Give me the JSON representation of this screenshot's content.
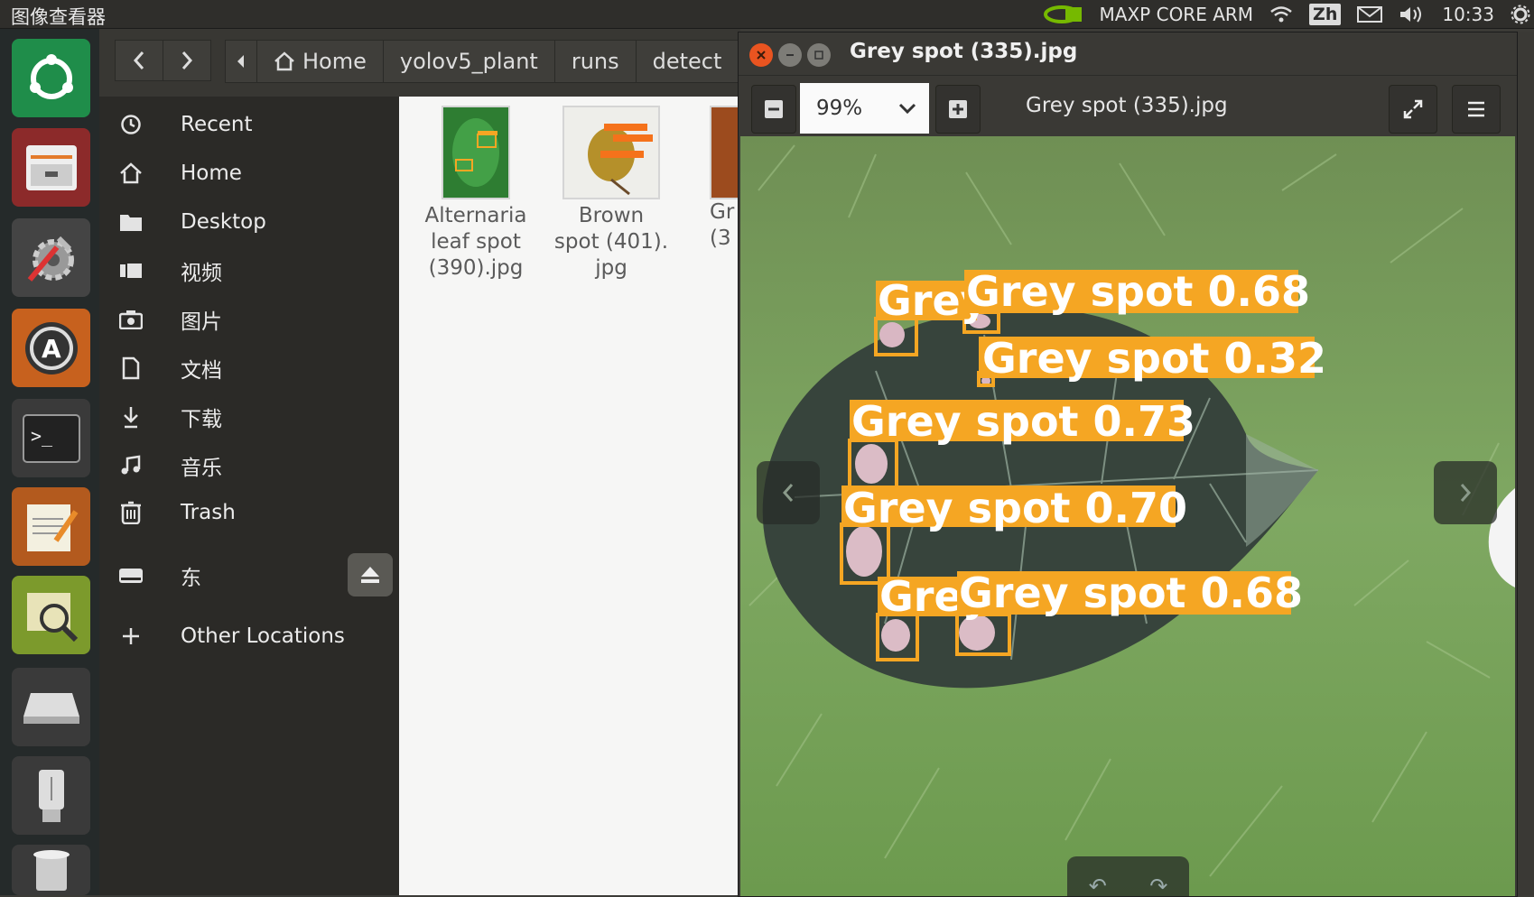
{
  "topbar": {
    "app_title": "图像查看器",
    "network": "MAXP CORE ARM",
    "lang": "Zh",
    "time": "10:33"
  },
  "launcher": {
    "items": [
      "ubuntu-software",
      "file-manager",
      "system-settings",
      "software-updater",
      "terminal",
      "text-editor",
      "image-viewer",
      "drive",
      "usb-drive",
      "trash"
    ]
  },
  "filemanager": {
    "breadcrumb": [
      "Home",
      "yolov5_plant",
      "runs",
      "detect"
    ],
    "sidebar": {
      "recent": "Recent",
      "home": "Home",
      "desktop": "Desktop",
      "videos": "视频",
      "pictures": "图片",
      "documents": "文档",
      "downloads": "下载",
      "music": "音乐",
      "trash": "Trash",
      "volume": "东",
      "other": "Other Locations"
    },
    "files": [
      {
        "line1": "Alternaria",
        "line2": "leaf spot",
        "line3": "(390).jpg"
      },
      {
        "line1": "Brown",
        "line2": "spot (401).",
        "line3": "jpg"
      },
      {
        "line1": "Gr",
        "line2": "(3",
        "line3": ""
      }
    ]
  },
  "viewer": {
    "window_title": "Grey spot (335).jpg",
    "zoom": "99%",
    "filename": "Grey spot (335).jpg",
    "detections": [
      {
        "label": "Grey",
        "partial": true
      },
      {
        "label": "Grey spot 0.68"
      },
      {
        "label": "Grey spot 0.32"
      },
      {
        "label": "Grey spot 0.73"
      },
      {
        "label": "Grey spot 0.70"
      },
      {
        "label": "Grey",
        "partial": true
      },
      {
        "label": "Grey spot 0.68"
      }
    ]
  },
  "colors": {
    "detection": "#f5a623",
    "close": "#e95420",
    "panel": "#2f2e2b"
  }
}
